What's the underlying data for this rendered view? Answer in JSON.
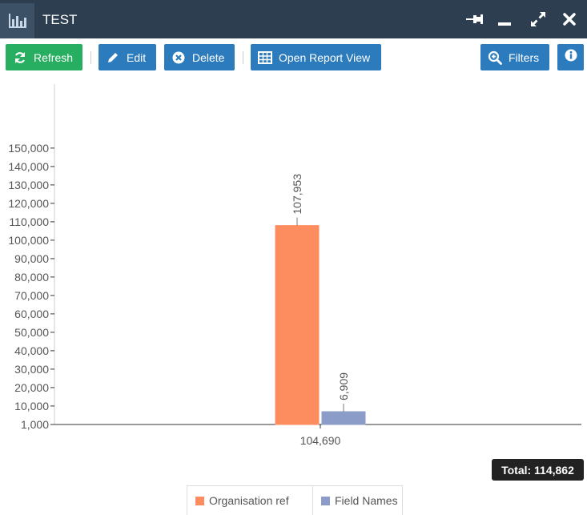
{
  "window": {
    "title": "TEST",
    "icons": {
      "app": "bar-chart-icon",
      "pin": "pin-icon",
      "minimize": "minimize-icon",
      "maximize": "expand-icon",
      "close": "close-icon"
    }
  },
  "toolbar": {
    "refresh_label": "Refresh",
    "edit_label": "Edit",
    "delete_label": "Delete",
    "open_report_label": "Open Report View",
    "filters_label": "Filters",
    "icons": {
      "refresh": "refresh-icon",
      "edit": "pencil-icon",
      "delete": "delete-circle-icon",
      "report": "table-icon",
      "filters": "zoom-in-icon",
      "info": "info-icon"
    }
  },
  "colors": {
    "titlebar": "#2c3e50",
    "green": "#27ae60",
    "blue": "#2b7bbd",
    "series1": "#fd8c5f",
    "series2": "#8c9cc9"
  },
  "total": {
    "label": "Total: 114,862"
  },
  "chart_data": {
    "type": "bar",
    "categories": [
      "104,690"
    ],
    "series": [
      {
        "name": "Organisation ref",
        "values": [
          107953
        ],
        "label": "107,953",
        "color": "#fd8c5f"
      },
      {
        "name": "Field Names",
        "values": [
          6909
        ],
        "label": "6,909",
        "color": "#8c9cc9"
      }
    ],
    "y_ticks": [
      "1,000",
      "10,000",
      "20,000",
      "30,000",
      "40,000",
      "50,000",
      "60,000",
      "70,000",
      "80,000",
      "90,000",
      "100,000",
      "110,000",
      "120,000",
      "130,000",
      "140,000",
      "150,000"
    ],
    "ylim": [
      1000,
      150000
    ],
    "legend": "bottom",
    "grid": false
  }
}
